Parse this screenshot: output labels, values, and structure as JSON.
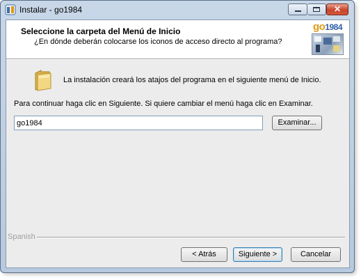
{
  "window": {
    "title": "Instalar - go1984",
    "minimize_label": "minimize",
    "maximize_label": "maximize",
    "close_glyph": "✕"
  },
  "header": {
    "title": "Seleccione la carpeta del Menú de Inicio",
    "subtitle": "¿En dónde deberán colocarse los iconos de acceso directo al programa?",
    "logo_text_prefix": "go",
    "logo_text_number": "1984"
  },
  "body": {
    "info_text": "La instalación creará los atajos del programa en el siguiente menú de Inicio.",
    "continue_text": "Para continuar haga clic en Siguiente. Si quiere cambiar el menú haga clic en Examinar.",
    "folder_value": "go1984",
    "browse_label": "Examinar..."
  },
  "footer": {
    "language_label": "Spanish",
    "back_label": "< Atrás",
    "next_label": "Siguiente >",
    "cancel_label": "Cancelar"
  },
  "colors": {
    "title_bar": "#c8d7e8",
    "close_button": "#c9442b",
    "logo_orange": "#e09a12",
    "logo_blue": "#2e5fa8"
  }
}
